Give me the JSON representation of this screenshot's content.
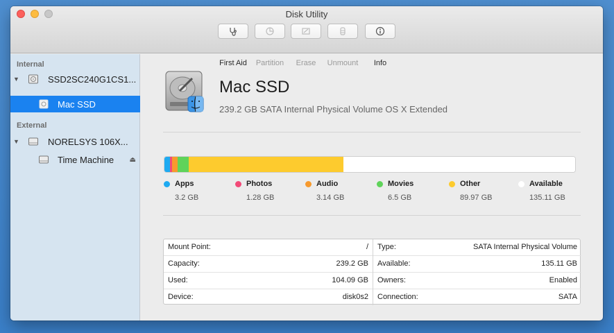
{
  "window": {
    "title": "Disk Utility"
  },
  "toolbar": {
    "buttons": [
      {
        "label": "First Aid",
        "icon": "stethoscope-icon",
        "enabled": true
      },
      {
        "label": "Partition",
        "icon": "pie-chart-icon",
        "enabled": false
      },
      {
        "label": "Erase",
        "icon": "erase-icon",
        "enabled": false
      },
      {
        "label": "Unmount",
        "icon": "unmount-icon",
        "enabled": false
      },
      {
        "label": "Info",
        "icon": "info-icon",
        "enabled": true
      }
    ]
  },
  "sidebar": {
    "sections": [
      {
        "header": "Internal",
        "device": {
          "label": "SSD2SC240G1CS1...",
          "icon": "internal-disk-icon"
        },
        "volumes": [
          {
            "label": "Mac SSD",
            "icon": "volume-icon",
            "selected": true
          }
        ]
      },
      {
        "header": "External",
        "device": {
          "label": "NORELSYS 106X...",
          "icon": "external-disk-icon"
        },
        "volumes": [
          {
            "label": "Time Machine",
            "icon": "external-volume-icon",
            "eject": "⏏"
          }
        ]
      }
    ]
  },
  "volume": {
    "name": "Mac SSD",
    "description": "239.2 GB SATA Internal Physical Volume OS X Extended",
    "icon": "hard-drive-finder-icon"
  },
  "usage": {
    "capacity_gb": 239.2,
    "categories": [
      {
        "name": "Apps",
        "size": "3.2 GB",
        "gb": 3.2,
        "color": "#1eaaf1"
      },
      {
        "name": "Photos",
        "size": "1.28 GB",
        "gb": 1.28,
        "color": "#f24a78"
      },
      {
        "name": "Audio",
        "size": "3.14 GB",
        "gb": 3.14,
        "color": "#f79a2e"
      },
      {
        "name": "Movies",
        "size": "6.5 GB",
        "gb": 6.5,
        "color": "#5fd35a"
      },
      {
        "name": "Other",
        "size": "89.97 GB",
        "gb": 89.97,
        "color": "#fdcb2e"
      },
      {
        "name": "Available",
        "size": "135.11 GB",
        "gb": 135.11,
        "color": "#ffffff"
      }
    ]
  },
  "info": {
    "left": [
      {
        "key": "Mount Point:",
        "value": "/"
      },
      {
        "key": "Capacity:",
        "value": "239.2 GB"
      },
      {
        "key": "Used:",
        "value": "104.09 GB"
      },
      {
        "key": "Device:",
        "value": "disk0s2"
      }
    ],
    "right": [
      {
        "key": "Type:",
        "value": "SATA Internal Physical Volume"
      },
      {
        "key": "Available:",
        "value": "135.11 GB"
      },
      {
        "key": "Owners:",
        "value": "Enabled"
      },
      {
        "key": "Connection:",
        "value": "SATA"
      }
    ]
  }
}
